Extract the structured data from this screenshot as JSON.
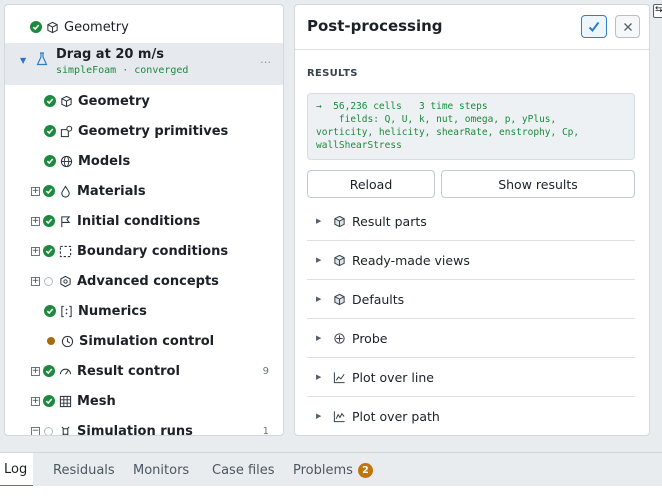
{
  "tree": {
    "top_item": {
      "label": "Geometry"
    },
    "run": {
      "title": "Drag at 20 m/s",
      "subtitle": "simpleFoam · converged",
      "more": "…"
    },
    "items": [
      {
        "label": "Geometry",
        "status": "done",
        "icon": "cube-icon"
      },
      {
        "label": "Geometry primitives",
        "status": "done",
        "icon": "primitives-icon"
      },
      {
        "label": "Models",
        "status": "done",
        "icon": "globe-icon"
      },
      {
        "label": "Materials",
        "status": "done",
        "icon": "droplet-icon",
        "expandable": true
      },
      {
        "label": "Initial conditions",
        "status": "done",
        "icon": "flag-icon",
        "expandable": true
      },
      {
        "label": "Boundary conditions",
        "status": "done",
        "icon": "boundary-icon",
        "expandable": true
      },
      {
        "label": "Advanced concepts",
        "status": "empty",
        "icon": "hexagon-icon",
        "expandable": true
      },
      {
        "label": "Numerics",
        "status": "done",
        "icon": "numerics-icon"
      },
      {
        "label": "Simulation control",
        "status": "warning",
        "icon": "clock-icon"
      },
      {
        "label": "Result control",
        "status": "done",
        "icon": "gauge-icon",
        "expandable": true,
        "count": "9"
      },
      {
        "label": "Mesh",
        "status": "done",
        "icon": "grid-icon",
        "expandable": true
      },
      {
        "label": "Simulation runs",
        "status": "empty",
        "icon": "runs-icon",
        "expandable": true,
        "expanded": true,
        "count": "1"
      }
    ]
  },
  "panel": {
    "title": "Post-processing",
    "section_label": "RESULTS",
    "console": "→  56,236 cells   3 time steps\n    fields: Q, U, k, nut, omega, p, yPlus,\nvorticity, helicity, shearRate, enstrophy, Cp,\nwallShearStress",
    "reload_label": "Reload",
    "show_results_label": "Show results",
    "accordion": [
      {
        "label": "Result parts",
        "icon": "parts-icon"
      },
      {
        "label": "Ready-made views",
        "icon": "views-icon"
      },
      {
        "label": "Defaults",
        "icon": "defaults-icon"
      },
      {
        "label": "Probe",
        "icon": "crosshair-icon"
      },
      {
        "label": "Plot over line",
        "icon": "line-chart-icon"
      },
      {
        "label": "Plot over path",
        "icon": "path-chart-icon"
      }
    ]
  },
  "bottom_tabs": [
    {
      "label": "Log",
      "active": true
    },
    {
      "label": "Residuals"
    },
    {
      "label": "Monitors"
    },
    {
      "label": "Case files"
    },
    {
      "label": "Problems",
      "badge": "2"
    }
  ],
  "colors": {
    "accent": "#2f7fc1",
    "success": "#1c8a3e",
    "warning": "#a86a10",
    "badge": "#c2750f"
  }
}
